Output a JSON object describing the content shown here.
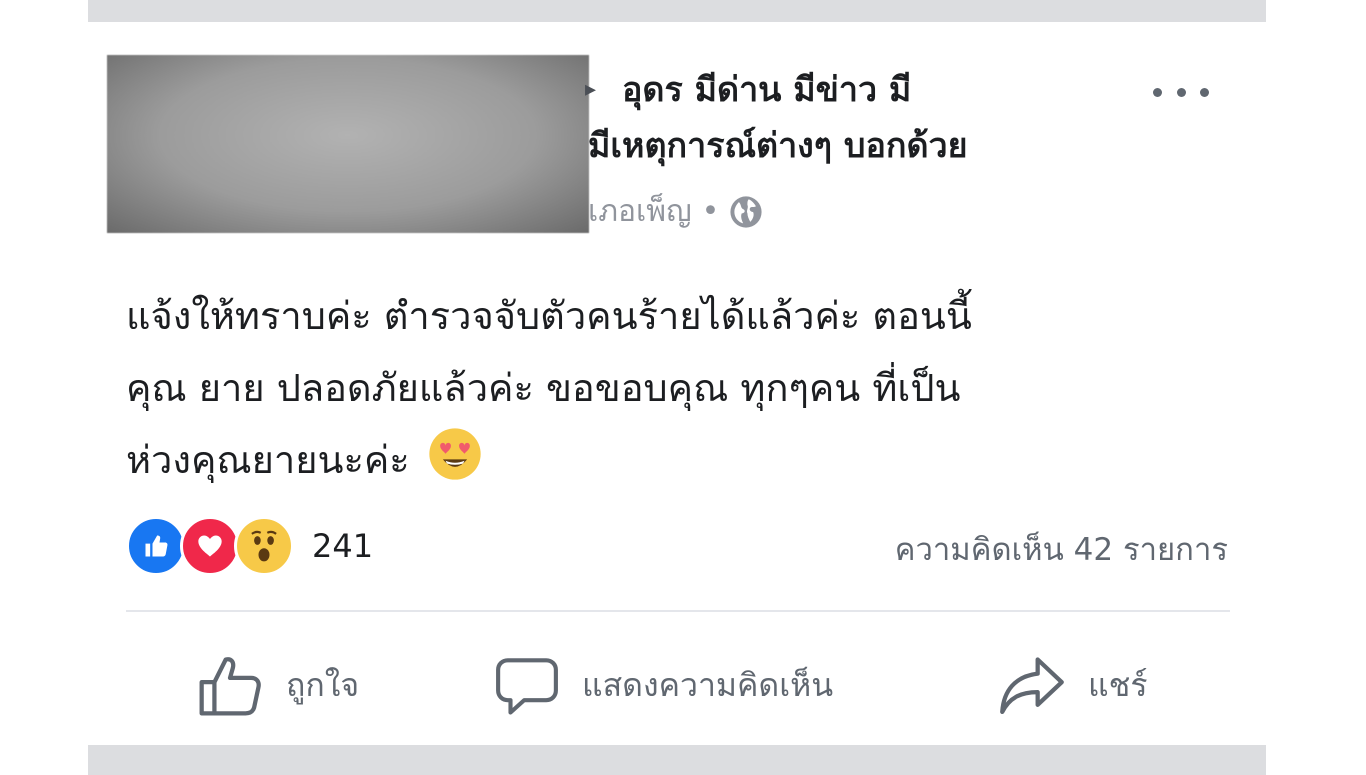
{
  "post": {
    "page_name_line1": "อุดร มีด่าน มีข่าว มี",
    "page_name_line2": "มีเหตุการณ์ต่างๆ บอกด้วย",
    "author_fragment": "เภอเพ็ญ",
    "separator": "•",
    "privacy_icon": "globe-icon",
    "more_icon": "more-options-icon",
    "text_lines": [
      "แจ้งให้ทราบค่ะ ตำรวจจับตัวคนร้ายได้แล้วค่ะ  ตอนนี้",
      "คุณ ยาย ปลอดภัยแล้วค่ะ  ขอขอบคุณ ทุกๆคน ที่เป็น",
      "ห่วงคุณยายนะค่ะ"
    ],
    "inline_emoji": "heart-eyes-emoji"
  },
  "stats": {
    "reaction_icons": [
      "like-reaction-icon",
      "love-reaction-icon",
      "wow-reaction-icon"
    ],
    "reaction_count": "241",
    "comment_count_label": "ความคิดเห็น 42 รายการ"
  },
  "actions": {
    "like_label": "ถูกใจ",
    "comment_label": "แสดงความคิดเห็น",
    "share_label": "แชร์"
  },
  "colors": {
    "like_blue": "#1877f2",
    "love_red": "#f0284a",
    "wow_yellow": "#f7c948",
    "muted_text": "#606770",
    "band_gray": "#dcdde0"
  }
}
